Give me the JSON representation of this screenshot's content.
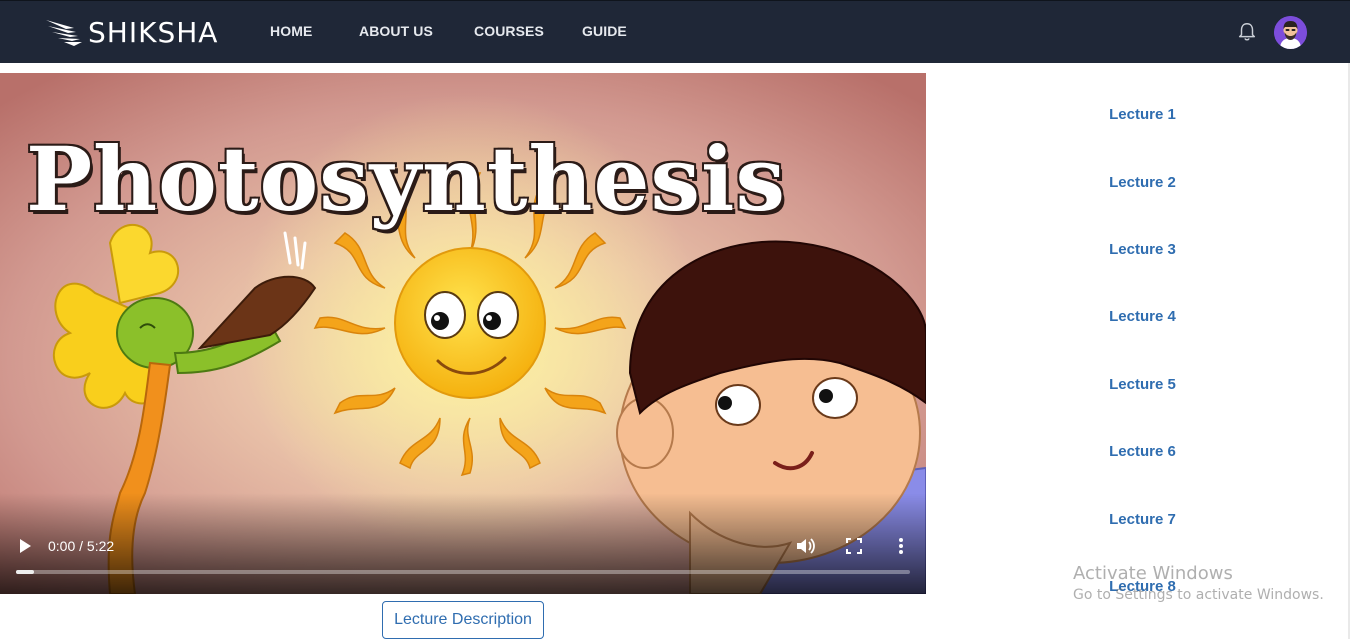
{
  "brand": {
    "name": "SHIKSHA"
  },
  "nav": {
    "links": [
      "HOME",
      "ABOUT US",
      "COURSES",
      "GUIDE"
    ],
    "icons": [
      "bell-icon",
      "avatar"
    ]
  },
  "video": {
    "title_text": "Photosynthesis",
    "time": "0:00 / 5:22",
    "progress": 0.02
  },
  "lectures": [
    "Lecture 1",
    "Lecture 2",
    "Lecture 3",
    "Lecture 4",
    "Lecture 5",
    "Lecture 6",
    "Lecture 7",
    "Lecture 8"
  ],
  "description_button": "Lecture Description",
  "watermark": {
    "title": "Activate Windows",
    "subtitle": "Go to Settings to activate Windows."
  },
  "colors": {
    "navbar": "#1f2737",
    "link": "#2f6db0",
    "avatar_bg": "#7c4ddb"
  }
}
